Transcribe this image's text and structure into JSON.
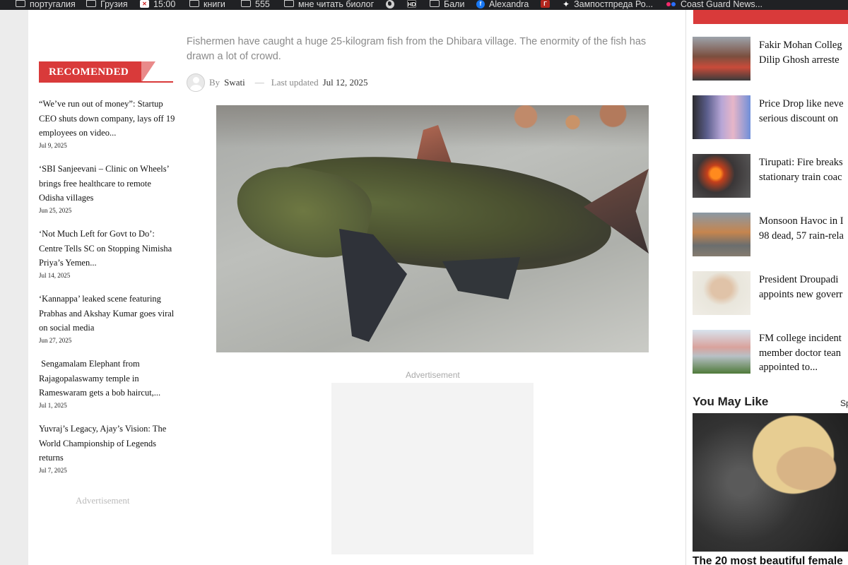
{
  "browser": {
    "bookmarks": [
      {
        "label": "португалия",
        "icon": "folder-icon"
      },
      {
        "label": "Грузия",
        "icon": "folder-icon"
      },
      {
        "label": "15:00",
        "icon": "site-favicon"
      },
      {
        "label": "книги",
        "icon": "folder-icon"
      },
      {
        "label": "555",
        "icon": "folder-icon"
      },
      {
        "label": "мне читать биолог",
        "icon": "folder-icon"
      },
      {
        "label": "",
        "icon": "globe-icon"
      },
      {
        "label": "HD",
        "icon": "hd-favicon"
      },
      {
        "label": "Бали",
        "icon": "folder-icon"
      },
      {
        "label": "Alexandra",
        "icon": "facebook-icon"
      },
      {
        "label": "Г",
        "icon": "site-favicon"
      },
      {
        "label": "Зампостпреда Ро...",
        "icon": "sparkle-icon"
      },
      {
        "label": "Coast Guard News...",
        "icon": "flickr-icon"
      }
    ]
  },
  "sidebar": {
    "heading": "RECOMENDED",
    "items": [
      {
        "title": "“We’ve run out of money”: Startup CEO shuts down company, lays off 19 employees on video...",
        "date": "Jul 9, 2025"
      },
      {
        "title": "‘SBI Sanjeevani – Clinic on Wheels’ brings free healthcare to remote Odisha villages",
        "date": "Jun 25, 2025"
      },
      {
        "title": "‘Not Much Left for Govt to Do’: Centre Tells SC on Stopping Nimisha Priya’s Yemen...",
        "date": "Jul 14, 2025"
      },
      {
        "title": "‘Kannappa’ leaked scene featuring Prabhas and Akshay Kumar goes viral on social media",
        "date": "Jun 27, 2025"
      },
      {
        "title": " Sengamalam Elephant from Rajagopalaswamy temple in Rameswaram gets a bob haircut,...",
        "date": "Jul 1, 2025"
      },
      {
        "title": "Yuvraj’s Legacy, Ajay’s Vision: The World Championship of Legends returns",
        "date": "Jul 7, 2025"
      }
    ],
    "ad_label": "Advertisement"
  },
  "article": {
    "standfirst": "Fishermen have caught a huge 25-kilogram fish from the Dhibara village. The enormity of the fish has drawn a lot of crowd.",
    "byline_prefix": "By",
    "author": "Swati",
    "separator": "—",
    "updated_label": "Last updated",
    "updated_date": "Jul 12, 2025",
    "ad_label": "Advertisement"
  },
  "right_column": {
    "news": [
      {
        "title_lines": [
          "Fakir Mohan Colleg",
          "Dilip Ghosh arreste"
        ]
      },
      {
        "title_lines": [
          "Price Drop like neve",
          "serious discount on"
        ]
      },
      {
        "title_lines": [
          "Tirupati: Fire breaks",
          "stationary train coac"
        ]
      },
      {
        "title_lines": [
          "Monsoon Havoc in I",
          "98 dead, 57 rain-rela"
        ]
      },
      {
        "title_lines": [
          "President Droupadi",
          "appoints new goverr"
        ]
      },
      {
        "title_lines": [
          "FM college incident",
          "member doctor tean",
          "appointed to..."
        ]
      }
    ],
    "you_may_like": "You May Like",
    "sponsored": "Sp",
    "ymk_caption": "The 20 most beautiful female"
  },
  "colors": {
    "accent_red": "#d93a3a",
    "bookmarks_bg": "#202124"
  }
}
